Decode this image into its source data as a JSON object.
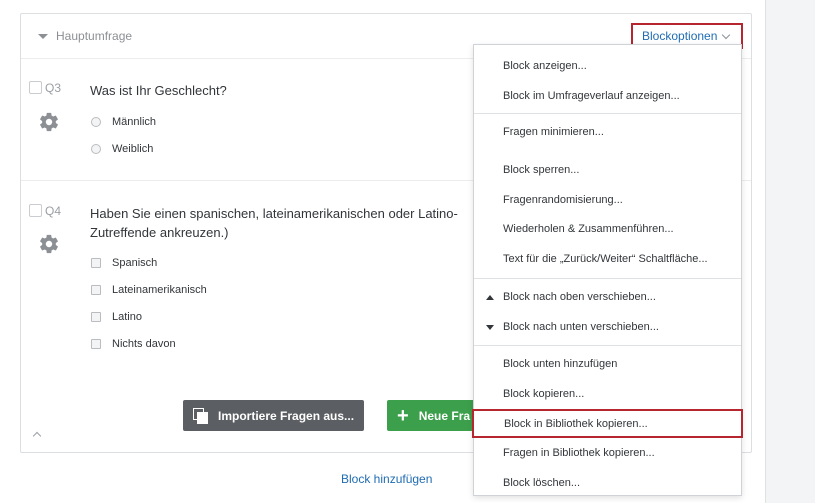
{
  "block": {
    "title": "Hauptumfrage",
    "options_label": "Blockoptionen"
  },
  "questions": [
    {
      "id": "Q3",
      "text": "Was ist Ihr Geschlecht?",
      "type": "radio",
      "choices": [
        "Männlich",
        "Weiblich"
      ]
    },
    {
      "id": "Q4",
      "text_line1": "Haben Sie einen spanischen, lateinamerikanischen oder Latino-",
      "text_line2": "Zutreffende ankreuzen.)",
      "type": "checkbox",
      "choices": [
        "Spanisch",
        "Lateinamerikanisch",
        "Latino",
        "Nichts davon"
      ]
    }
  ],
  "buttons": {
    "import_label": "Importiere Fragen aus...",
    "new_label": "Neue Fra"
  },
  "add_block_label": "Block hinzufügen",
  "menu": {
    "items": [
      "Block anzeigen...",
      "Block im Umfrageverlauf anzeigen...",
      "Fragen minimieren...",
      "Block sperren...",
      "Fragenrandomisierung...",
      "Wiederholen & Zusammenführen...",
      "Text für die „Zurück/Weiter“ Schaltfläche...",
      "Block nach oben verschieben...",
      "Block nach unten verschieben...",
      "Block unten hinzufügen",
      "Block kopieren...",
      "Block in Bibliothek kopieren...",
      "Fragen in Bibliothek kopieren...",
      "Block löschen..."
    ]
  },
  "colors": {
    "highlight": "#b5262f",
    "link": "#1f6cb3",
    "import_button": "#5b5e62",
    "new_button": "#3c9f4b"
  }
}
